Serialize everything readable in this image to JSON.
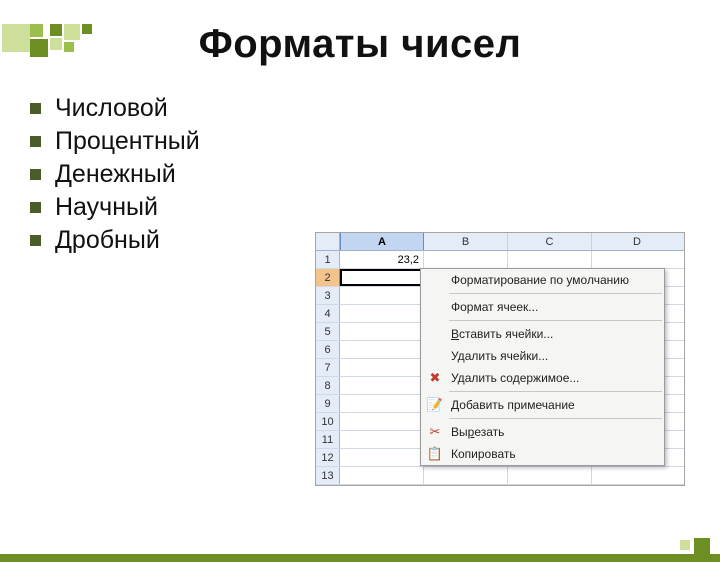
{
  "title": "Форматы чисел",
  "bullets": [
    "Числовой",
    "Процентный",
    "Денежный",
    "Научный",
    "Дробный"
  ],
  "sheet": {
    "cols": [
      "A",
      "B",
      "C",
      "D"
    ],
    "rows": [
      "1",
      "2",
      "3",
      "4",
      "5",
      "6",
      "7",
      "8",
      "9",
      "10",
      "11",
      "12",
      "13"
    ],
    "a1": "23,2",
    "selected_row": "2"
  },
  "menu": {
    "default_format": "Форматирование по умолчанию",
    "format_cells": "Формат ячеек...",
    "insert_pre": "В",
    "insert_post": "ставить ячейки...",
    "delete": "Удалить ячейки...",
    "clear": "Удалить содержимое...",
    "add_note_pre": "Д",
    "add_note_post": "обавить примечание",
    "cut_pre": "Вы",
    "cut_u": "р",
    "cut_post": "езать",
    "copy": "Копировать"
  },
  "icons": {
    "delete_content": "✖",
    "note": "📝",
    "cut": "✂",
    "copy": "📋"
  },
  "colors": {
    "accent": "#6c8e23",
    "bullet": "#4a5c2a"
  }
}
